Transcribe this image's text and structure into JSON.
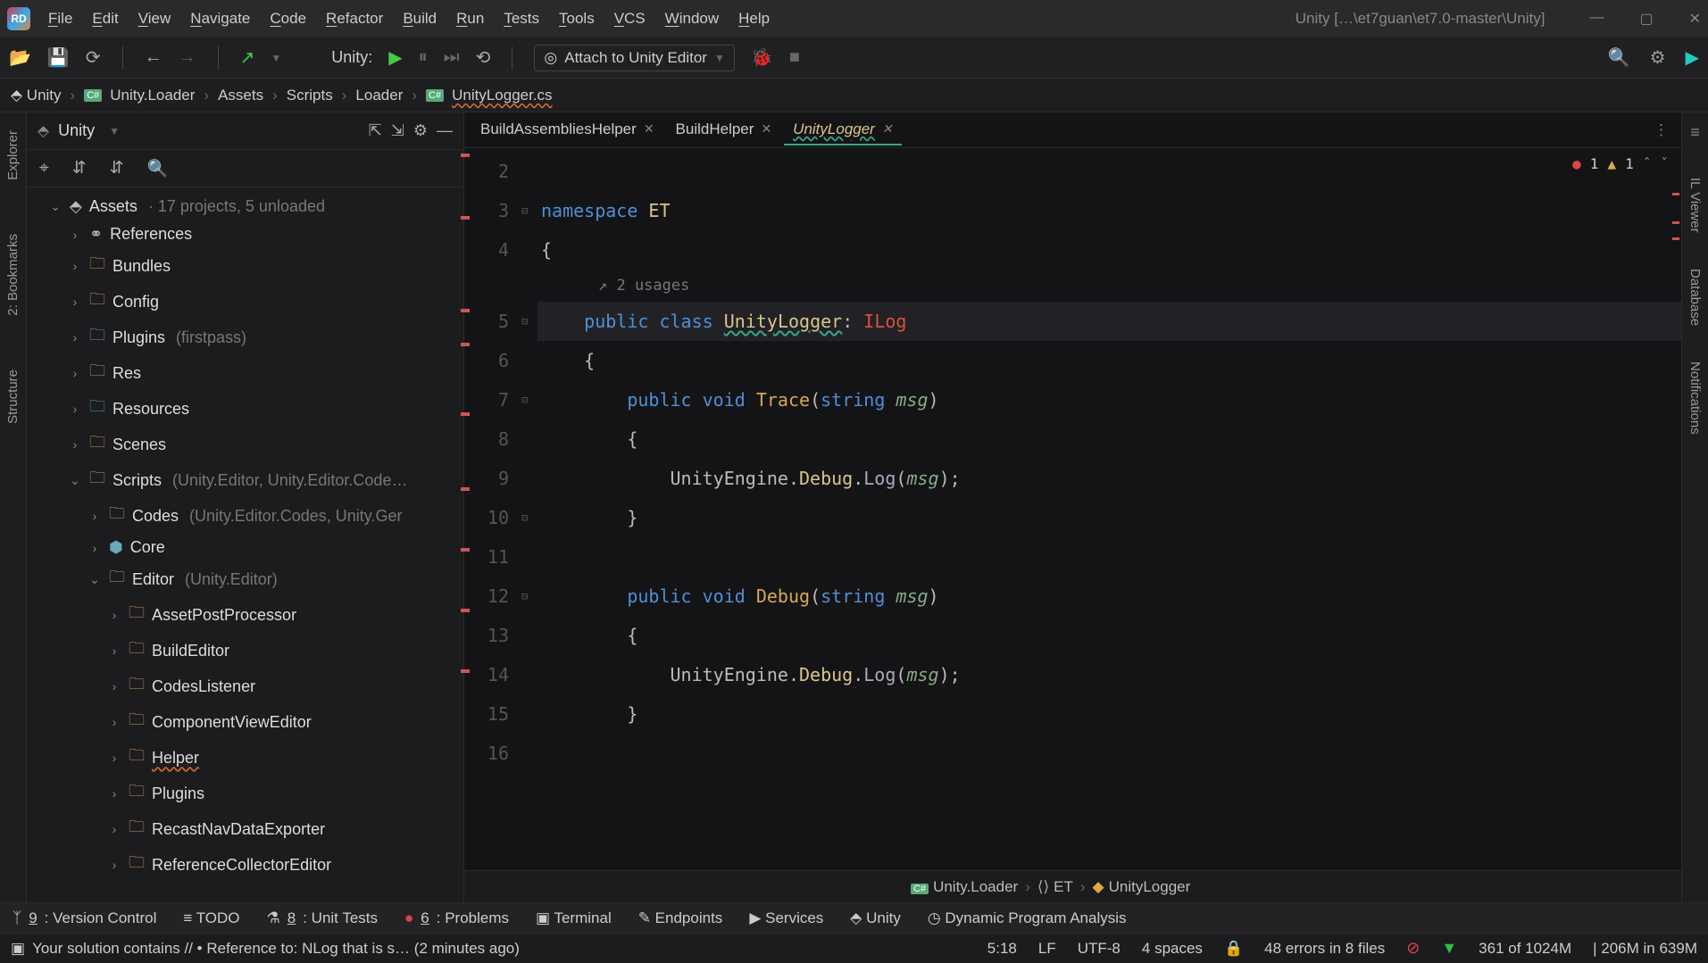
{
  "title": "Unity […\\et7guan\\et7.0-master\\Unity]",
  "menus": [
    "File",
    "Edit",
    "View",
    "Navigate",
    "Code",
    "Refactor",
    "Build",
    "Run",
    "Tests",
    "Tools",
    "VCS",
    "Window",
    "Help"
  ],
  "toolbar": {
    "run_config_label": "Unity:",
    "attach_label": "Attach to Unity Editor"
  },
  "breadcrumb": [
    {
      "icon": "unity",
      "label": "Unity"
    },
    {
      "icon": "cs",
      "label": "Unity.Loader"
    },
    {
      "label": "Assets"
    },
    {
      "label": "Scripts"
    },
    {
      "label": "Loader"
    },
    {
      "icon": "cs",
      "label": "UnityLogger.cs",
      "wavy": true
    }
  ],
  "sidebar": {
    "title": "Unity",
    "tree": [
      {
        "level": 0,
        "exp": "open",
        "icon": "unity",
        "label": "Assets",
        "note": "· 17 projects, 5 unloaded"
      },
      {
        "level": 1,
        "exp": "closed",
        "icon": "ref",
        "label": "References"
      },
      {
        "level": 1,
        "exp": "closed",
        "icon": "folder",
        "label": "Bundles"
      },
      {
        "level": 1,
        "exp": "closed",
        "icon": "folder",
        "label": "Config"
      },
      {
        "level": 1,
        "exp": "closed",
        "icon": "folder-blue",
        "label": "Plugins",
        "note": "(firstpass)"
      },
      {
        "level": 1,
        "exp": "closed",
        "icon": "folder",
        "label": "Res"
      },
      {
        "level": 1,
        "exp": "closed",
        "icon": "folder-blue",
        "label": "Resources"
      },
      {
        "level": 1,
        "exp": "closed",
        "icon": "folder",
        "label": "Scenes"
      },
      {
        "level": 1,
        "exp": "open",
        "icon": "folder",
        "label": "Scripts",
        "note": "(Unity.Editor, Unity.Editor.Code…"
      },
      {
        "level": 2,
        "exp": "closed",
        "icon": "folder",
        "label": "Codes",
        "note": "(Unity.Editor.Codes, Unity.Ger"
      },
      {
        "level": 2,
        "exp": "closed",
        "icon": "core",
        "label": "Core"
      },
      {
        "level": 2,
        "exp": "open",
        "icon": "folder",
        "label": "Editor",
        "note": "(Unity.Editor)"
      },
      {
        "level": 3,
        "exp": "closed",
        "icon": "folder",
        "label": "AssetPostProcessor"
      },
      {
        "level": 3,
        "exp": "closed",
        "icon": "folder",
        "label": "BuildEditor"
      },
      {
        "level": 3,
        "exp": "closed",
        "icon": "folder",
        "label": "CodesListener"
      },
      {
        "level": 3,
        "exp": "closed",
        "icon": "folder",
        "label": "ComponentViewEditor"
      },
      {
        "level": 3,
        "exp": "closed",
        "icon": "folder",
        "label": "Helper",
        "wavy": true
      },
      {
        "level": 3,
        "exp": "closed",
        "icon": "folder",
        "label": "Plugins"
      },
      {
        "level": 3,
        "exp": "closed",
        "icon": "folder",
        "label": "RecastNavDataExporter"
      },
      {
        "level": 3,
        "exp": "closed",
        "icon": "folder",
        "label": "ReferenceCollectorEditor"
      }
    ]
  },
  "tabs": [
    {
      "label": "BuildAssembliesHelper",
      "active": false,
      "wavy": false
    },
    {
      "label": "BuildHelper",
      "active": false,
      "wavy": false
    },
    {
      "label": "UnityLogger",
      "active": true,
      "wavy": true
    }
  ],
  "indicators": {
    "errors": "1",
    "warnings": "1"
  },
  "code": {
    "usages": "2 usages",
    "lines": [
      2,
      3,
      4,
      5,
      6,
      7,
      8,
      9,
      10,
      11,
      12,
      13,
      14,
      15,
      16
    ],
    "ns": "namespace",
    "nsname": "ET",
    "pub": "public",
    "cls_kw": "class",
    "classname": "UnityLogger",
    "colon": ":",
    "interf": "ILog",
    "void": "void",
    "m1": "Trace",
    "m2": "Debug",
    "string": "string",
    "msg": "msg",
    "call_pkg": "UnityEngine",
    "call_cls": "Debug",
    "call_m": "Log"
  },
  "bot_bc": [
    {
      "icon": "cs",
      "label": "Unity.Loader"
    },
    {
      "icon": "ns",
      "label": "ET"
    },
    {
      "icon": "cls",
      "label": "UnityLogger"
    }
  ],
  "bottom_tools": [
    {
      "icon": "branch",
      "key": "9",
      "label": "Version Control"
    },
    {
      "icon": "list",
      "label": "TODO"
    },
    {
      "icon": "flask",
      "key": "8",
      "label": "Unit Tests"
    },
    {
      "icon": "err",
      "key": "6",
      "label": "Problems"
    },
    {
      "icon": "term",
      "label": "Terminal"
    },
    {
      "icon": "wand",
      "label": "Endpoints"
    },
    {
      "icon": "play",
      "label": "Services"
    },
    {
      "icon": "unity",
      "label": "Unity"
    },
    {
      "icon": "gauge",
      "label": "Dynamic Program Analysis"
    }
  ],
  "status": {
    "msg": "Your solution contains // • Reference to: NLog that is s… (2 minutes ago)",
    "pos": "5:18",
    "eol": "LF",
    "enc": "UTF-8",
    "indent": "4 spaces",
    "errs": "48 errors in 8 files",
    "mem1": "361 of 1024M",
    "mem2": "| 206M in 639M"
  },
  "left_strip": [
    "Explorer",
    "2: Bookmarks",
    "Structure"
  ],
  "right_strip": [
    "IL Viewer",
    "Database",
    "Notifications"
  ]
}
